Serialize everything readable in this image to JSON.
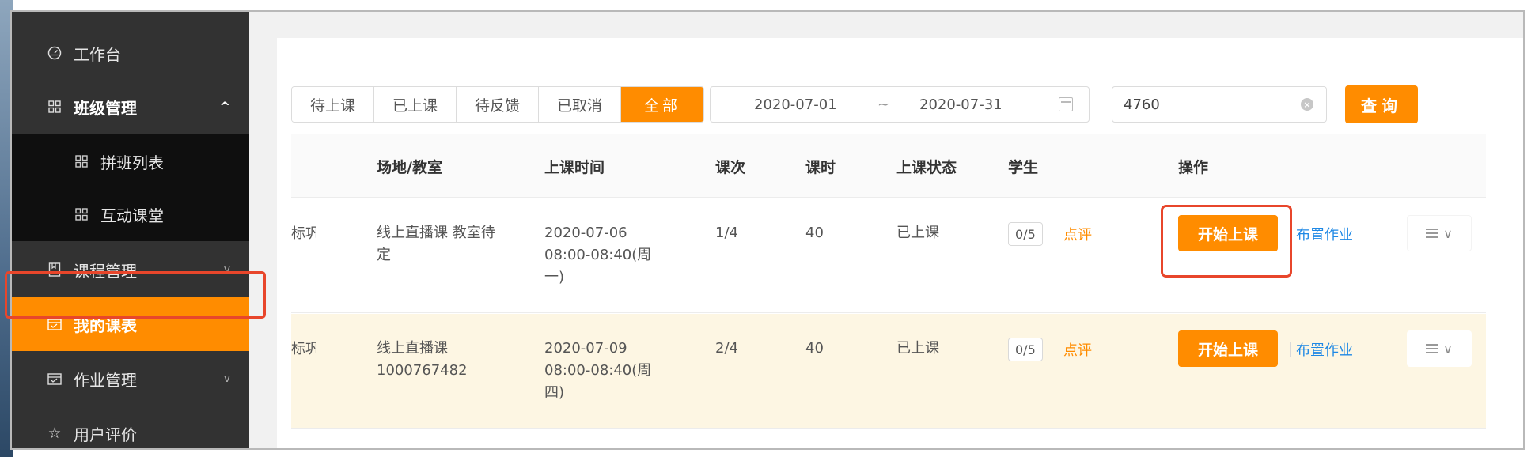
{
  "sidebar": {
    "items": [
      {
        "label": "工作台",
        "icon": "dashboard-icon"
      },
      {
        "label": "班级管理",
        "icon": "grid-icon",
        "caret": "^"
      },
      {
        "label": "拼班列表",
        "icon": "grid-icon"
      },
      {
        "label": "互动课堂",
        "icon": "grid-icon"
      },
      {
        "label": "课程管理",
        "icon": "book-icon",
        "caret": "v"
      },
      {
        "label": "我的课表",
        "icon": "calendar-icon"
      },
      {
        "label": "作业管理",
        "icon": "calendar-icon",
        "caret": "v"
      },
      {
        "label": "用户评价",
        "icon": "star-icon"
      }
    ]
  },
  "filters": {
    "tabs": [
      "待上课",
      "已上课",
      "待反馈",
      "已取消",
      "全部"
    ],
    "active_tab": "全部",
    "date_start": "2020-07-01",
    "date_sep": "~",
    "date_end": "2020-07-31",
    "search_value": "4760",
    "query_label": "查询"
  },
  "table": {
    "headers": {
      "venue": "场地/教室",
      "time": "上课时间",
      "session": "课次",
      "hours": "课时",
      "status": "上课状态",
      "students": "学生",
      "actions": "操作"
    },
    "rows": [
      {
        "teacher_clip": "谭标巩",
        "venue_line1": "线上直播课 教室待",
        "venue_line2": "定",
        "time_line1": "2020-07-06",
        "time_line2": "08:00-08:40(周",
        "time_line3": "一)",
        "session": "1/4",
        "hours": "40",
        "status": "已上课",
        "students": "0/5",
        "review": "点评",
        "start": "开始上课",
        "homework": "布置作业"
      },
      {
        "teacher_clip": "谭标巩",
        "venue_line1": "线上直播课",
        "venue_line2": "1000767482",
        "time_line1": "2020-07-09",
        "time_line2": "08:00-08:40(周",
        "time_line3": "四)",
        "session": "2/4",
        "hours": "40",
        "status": "已上课",
        "students": "0/5",
        "review": "点评",
        "start": "开始上课",
        "homework": "布置作业"
      }
    ]
  },
  "colors": {
    "accent": "#ff8c00",
    "sidebar_bg": "#323232",
    "link": "#1e88e5",
    "highlight": "#e8462b"
  }
}
